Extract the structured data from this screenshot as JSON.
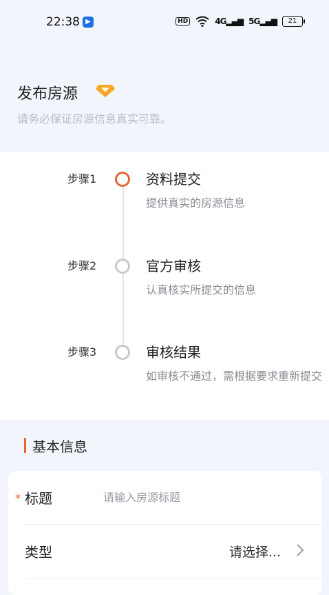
{
  "status_bar": {
    "time": "22:38",
    "app_badge": "▶",
    "hd": "HD",
    "net1": "4G",
    "net2": "5G",
    "battery": "21"
  },
  "header": {
    "title": "发布房源",
    "subtitle": "请务必保证房源信息真实可靠。"
  },
  "steps": [
    {
      "label": "步骤1",
      "title": "资料提交",
      "desc": "提供真实的房源信息",
      "state": "active"
    },
    {
      "label": "步骤2",
      "title": "官方审核",
      "desc": "认真核实所提交的信息",
      "state": "pending"
    },
    {
      "label": "步骤3",
      "title": "审核结果",
      "desc": "如审核不通过，需根据要求重新提交",
      "state": "pending"
    }
  ],
  "section": {
    "title": "基本信息"
  },
  "form": {
    "title_field": {
      "label": "标题",
      "required_mark": "*",
      "placeholder": "请输入房源标题",
      "value": ""
    },
    "type_field": {
      "label": "类型",
      "value": "请选择..."
    }
  },
  "colors": {
    "accent": "#e8653a",
    "pending": "#c9c9c9",
    "page_bg": "#f2f5fb"
  }
}
